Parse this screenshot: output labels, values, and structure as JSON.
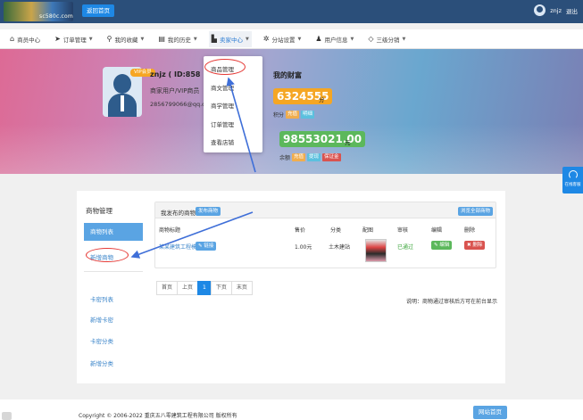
{
  "topbar": {
    "logo_text": "sc580c.com",
    "home_button": "返回首页",
    "username": "znjz",
    "logout": "退出"
  },
  "nav": {
    "items": [
      {
        "icon": "home-icon",
        "glyph": "⌂",
        "label": "商员中心",
        "caret": false
      },
      {
        "icon": "send-icon",
        "glyph": "➤",
        "label": "订单管理",
        "caret": true
      },
      {
        "icon": "search-icon",
        "glyph": "⚲",
        "label": "我的收藏",
        "caret": true
      },
      {
        "icon": "list-icon",
        "glyph": "▤",
        "label": "我的历史",
        "caret": true
      },
      {
        "icon": "file-icon",
        "glyph": "▙",
        "label": "卖家中心",
        "caret": true
      },
      {
        "icon": "gear-icon",
        "glyph": "✲",
        "label": "分站设置",
        "caret": true
      },
      {
        "icon": "user-icon",
        "glyph": "♟",
        "label": "用户信息",
        "caret": true
      },
      {
        "icon": "diamond-icon",
        "glyph": "◇",
        "label": "三级分销",
        "caret": true
      }
    ]
  },
  "dropdown": {
    "items": [
      "商品管理",
      "商文管理",
      "商学管理",
      "订单管理",
      "查看店铺"
    ]
  },
  "profile": {
    "vip_badge": "VIP会员",
    "name": "znjz ( ID:858 )",
    "role": "商家用户/VIP商员",
    "email": "2856799066@qq.com"
  },
  "wealth": {
    "title": "我的财富",
    "points": "6324555",
    "points_unit": "分",
    "points_label": "积分",
    "points_tags": [
      {
        "text": "充值",
        "color": "#f0ad4e"
      },
      {
        "text": "明细",
        "color": "#5bc0de"
      }
    ],
    "balance": "98553021.00",
    "balance_unit": "元",
    "balance_label": "余额",
    "balance_tags": [
      {
        "text": "充值",
        "color": "#f0ad4e"
      },
      {
        "text": "提现",
        "color": "#5bc0de"
      },
      {
        "text": "保证金",
        "color": "#d9534f"
      }
    ]
  },
  "sidebar": {
    "title": "商物管理",
    "active": "商物列表",
    "links": [
      "新增商物",
      "卡密列表",
      "新增卡密",
      "卡密分类",
      "新增分类"
    ]
  },
  "content": {
    "header_title": "我发布的商物",
    "add_button": "发布商物",
    "view_all_button": "浏览全部商物",
    "columns": [
      "商物标题",
      "售价",
      "分类",
      "配图",
      "审核",
      "编辑",
      "删除"
    ],
    "rows": [
      {
        "title": "某某建筑工程模板",
        "title_badge": "✎ 链接",
        "price": "1.00元",
        "category": "土木建站",
        "status": "已通过",
        "edit": "✎ 编辑",
        "delete": "✖ 删除"
      }
    ]
  },
  "pagination": {
    "items": [
      "首页",
      "上页",
      "1",
      "下页",
      "末页"
    ],
    "current": "1"
  },
  "note": "说明：商物通过审核后方可在前台显示",
  "footer": {
    "copyright": "Copyright © 2006-2022 重庆五八零建筑工程有限公司 版权所有",
    "site_home": "网站首页"
  },
  "widget": {
    "label": "在线客服"
  },
  "colors": {
    "topbar": "#2b4f7a",
    "accent": "#1e88e5",
    "sidebar_active": "#5aa4e3",
    "annotation_red": "#e53935",
    "annotation_blue": "#3f6fd8"
  }
}
